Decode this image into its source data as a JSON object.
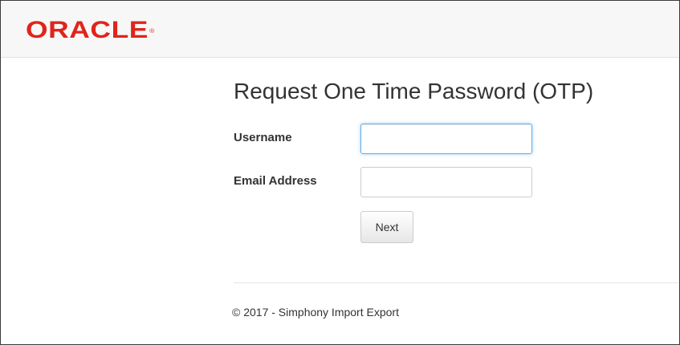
{
  "header": {
    "logo_text": "ORACLE",
    "logo_mark": "®",
    "brand_color": "#e0241b"
  },
  "form": {
    "title": "Request One Time Password (OTP)",
    "username_label": "Username",
    "username_value": "",
    "email_label": "Email Address",
    "email_value": "",
    "next_label": "Next"
  },
  "footer": {
    "text": "© 2017 - Simphony Import Export"
  }
}
